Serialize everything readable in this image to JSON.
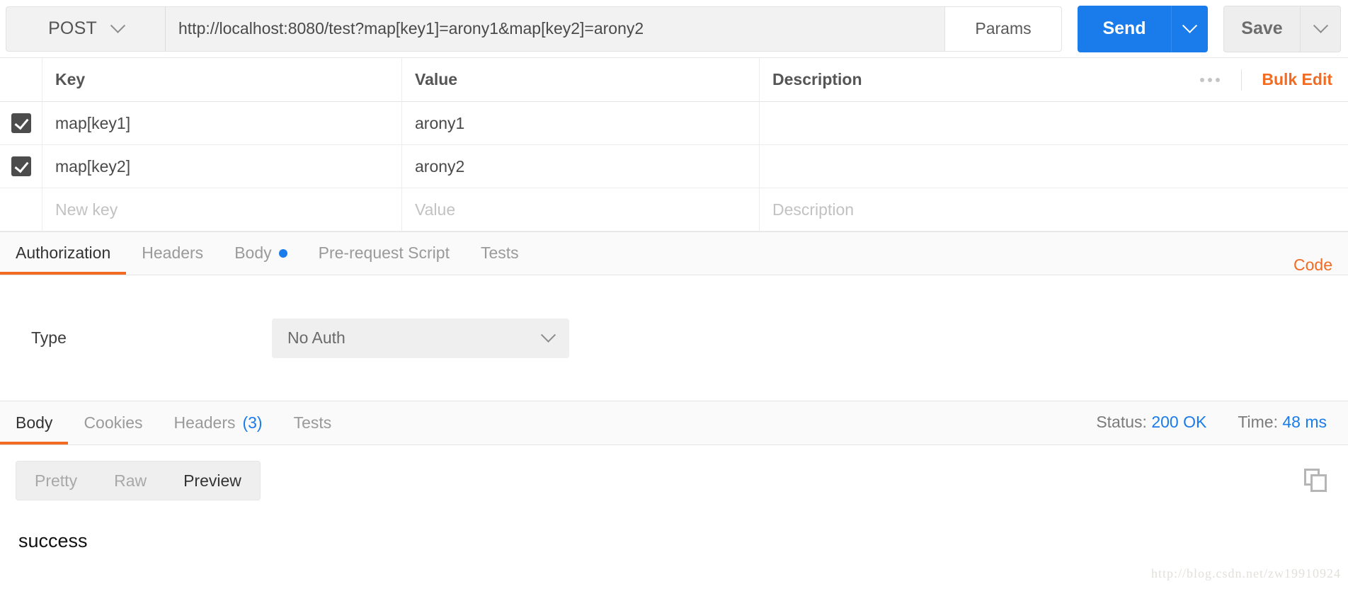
{
  "request_bar": {
    "method": "POST",
    "method_caret_icon": "chevron-down-icon",
    "url": "http://localhost:8080/test?map[key1]=arony1&map[key2]=arony2",
    "params_label": "Params",
    "send_label": "Send",
    "send_caret_icon": "chevron-down-icon",
    "save_label": "Save",
    "save_caret_icon": "chevron-down-icon",
    "accent_blue": "#1a7bea"
  },
  "params_table": {
    "columns": {
      "key": "Key",
      "value": "Value",
      "description": "Description"
    },
    "more_icon": "ellipsis-icon",
    "bulk_edit_label": "Bulk Edit",
    "rows": [
      {
        "checked": true,
        "key": "map[key1]",
        "value": "arony1",
        "description": ""
      },
      {
        "checked": true,
        "key": "map[key2]",
        "value": "arony2",
        "description": ""
      }
    ],
    "new_row": {
      "key_placeholder": "New key",
      "value_placeholder": "Value",
      "description_placeholder": "Description"
    }
  },
  "request_tabs": {
    "items": [
      {
        "label": "Authorization",
        "active": true,
        "dot": false
      },
      {
        "label": "Headers",
        "active": false,
        "dot": false
      },
      {
        "label": "Body",
        "active": false,
        "dot": true
      },
      {
        "label": "Pre-request Script",
        "active": false,
        "dot": false
      },
      {
        "label": "Tests",
        "active": false,
        "dot": false
      }
    ],
    "code_label": "Code"
  },
  "auth_panel": {
    "type_label": "Type",
    "selected_type": "No Auth",
    "caret_icon": "chevron-down-icon"
  },
  "response_tabs": {
    "items": [
      {
        "label": "Body",
        "active": true,
        "count": ""
      },
      {
        "label": "Cookies",
        "active": false,
        "count": ""
      },
      {
        "label": "Headers",
        "active": false,
        "count": "(3)"
      },
      {
        "label": "Tests",
        "active": false,
        "count": ""
      }
    ],
    "status_label": "Status:",
    "status_value": "200 OK",
    "time_label": "Time:",
    "time_value": "48 ms"
  },
  "response_body": {
    "format_options": [
      {
        "label": "Pretty",
        "active": false
      },
      {
        "label": "Raw",
        "active": false
      },
      {
        "label": "Preview",
        "active": true
      }
    ],
    "copy_icon": "copy-icon",
    "content": "success"
  },
  "watermark": "http://blog.csdn.net/zw19910924"
}
